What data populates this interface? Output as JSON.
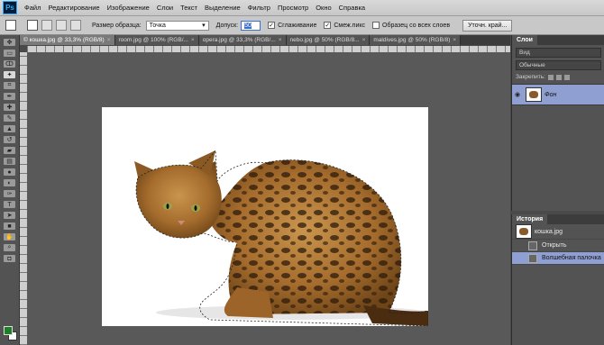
{
  "app": {
    "logo": "Ps"
  },
  "menu": [
    "Файл",
    "Редактирование",
    "Изображение",
    "Слои",
    "Текст",
    "Выделение",
    "Фильтр",
    "Просмотр",
    "Окно",
    "Справка"
  ],
  "options": {
    "sample_size_label": "Размер образца:",
    "sample_size_value": "Точка",
    "tolerance_label": "Допуск:",
    "tolerance_value": "50",
    "antialias_label": "Сглаживание",
    "contiguous_label": "Смеж.пикс",
    "all_layers_label": "Образец со всех слоев",
    "refine_button": "Уточн. край..."
  },
  "tabs": [
    {
      "label": "© кошка.jpg @ 33,3% (RGB/8)",
      "active": true
    },
    {
      "label": "room.jpg @ 100% (RGB/...",
      "active": false
    },
    {
      "label": "opera.jpg @ 33,3% (RGB/...",
      "active": false
    },
    {
      "label": "nebo.jpg @ 50% (RGB/8...",
      "active": false
    },
    {
      "label": "maldives.jpg @ 50% (RGB/8)",
      "active": false
    }
  ],
  "layers_panel": {
    "tab": "Слои",
    "kind_placeholder": "Вид",
    "blend_mode": "Обычные",
    "lock_label": "Закрепить:",
    "layer_name": "Фон"
  },
  "history_panel": {
    "tab": "История",
    "snapshot": "кошка.jpg",
    "items": [
      {
        "label": "Открыть",
        "selected": false
      },
      {
        "label": "Волшебная палочка",
        "selected": true
      }
    ]
  },
  "colors": {
    "foreground": "#1e7f27",
    "background": "#ffffff",
    "selection_highlight": "#8f9fd2"
  }
}
